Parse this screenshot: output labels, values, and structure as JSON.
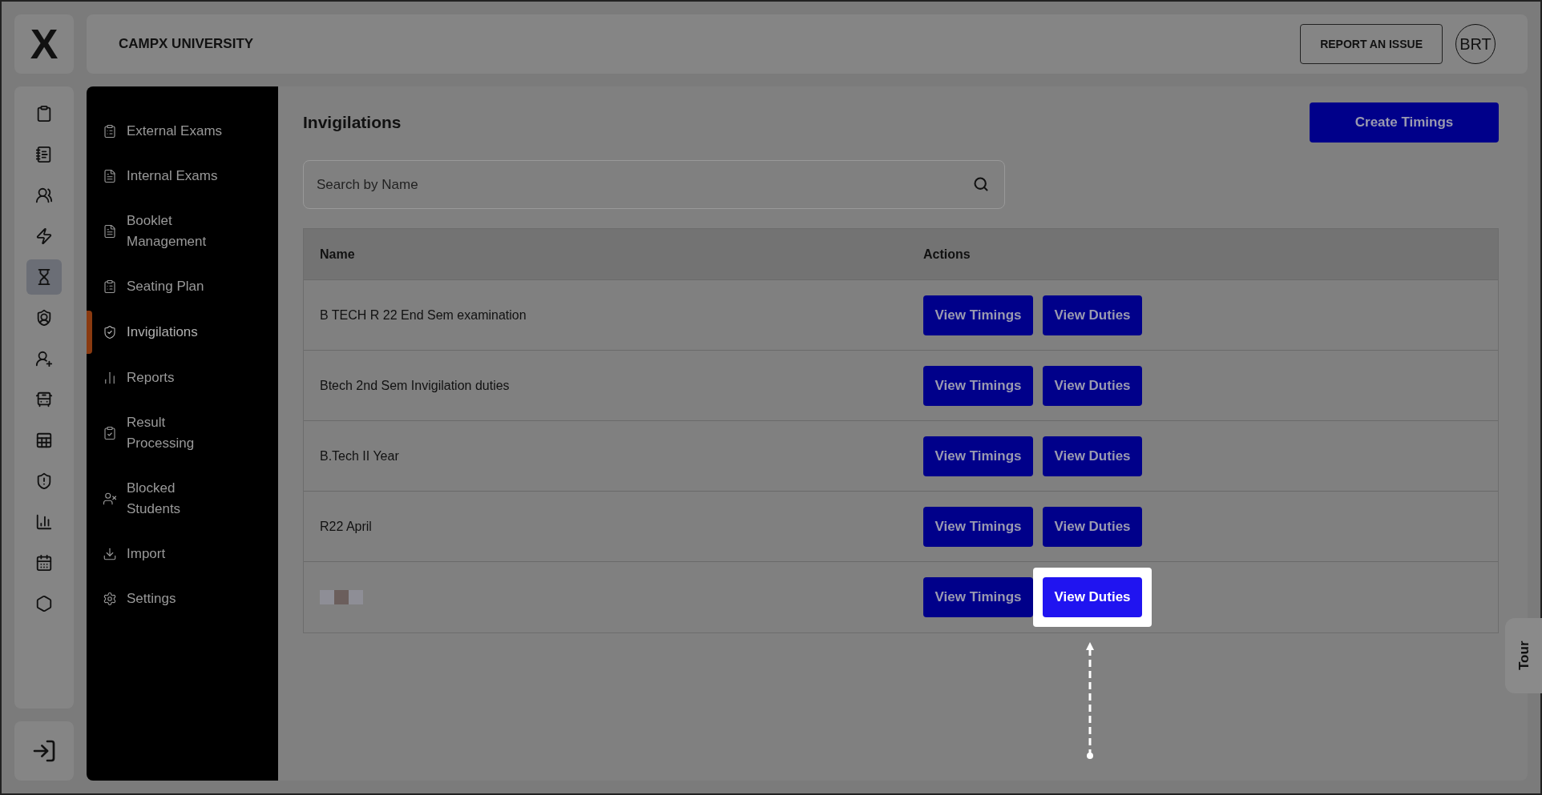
{
  "logo": "X",
  "header": {
    "title": "CAMPX UNIVERSITY",
    "report_button": "REPORT AN ISSUE",
    "avatar": "BRT"
  },
  "rail": [
    {
      "selected": false
    },
    {
      "selected": false
    },
    {
      "selected": false
    },
    {
      "selected": false
    },
    {
      "selected": true
    },
    {
      "selected": false
    },
    {
      "selected": false
    },
    {
      "selected": false
    },
    {
      "selected": false
    },
    {
      "selected": false
    },
    {
      "selected": false
    },
    {
      "selected": false
    },
    {
      "selected": false
    }
  ],
  "sidebar": {
    "items": [
      {
        "label": "External Exams",
        "selected": false
      },
      {
        "label": "Internal Exams",
        "selected": false
      },
      {
        "label": "Booklet Management",
        "selected": false
      },
      {
        "label": "Seating Plan",
        "selected": false
      },
      {
        "label": "Invigilations",
        "selected": true
      },
      {
        "label": "Reports",
        "selected": false
      },
      {
        "label": "Result Processing",
        "selected": false
      },
      {
        "label": "Blocked Students",
        "selected": false
      },
      {
        "label": "Import",
        "selected": false
      },
      {
        "label": "Settings",
        "selected": false
      }
    ]
  },
  "page": {
    "title": "Invigilations",
    "create_button": "Create Timings",
    "search": {
      "placeholder": "Search by Name"
    }
  },
  "table": {
    "columns": [
      "Name",
      "Actions"
    ],
    "rows": [
      {
        "name": "B TECH R 22 End Sem examination",
        "name_blurred": false,
        "timings_button": "View Timings",
        "duties_button": "View Duties",
        "duties_highlighted": false
      },
      {
        "name": "Btech 2nd Sem Invigilation duties",
        "name_blurred": false,
        "timings_button": "View Timings",
        "duties_button": "View Duties",
        "duties_highlighted": false
      },
      {
        "name": "B.Tech II Year",
        "name_blurred": false,
        "timings_button": "View Timings",
        "duties_button": "View Duties",
        "duties_highlighted": false
      },
      {
        "name": "R22 April",
        "name_blurred": false,
        "timings_button": "View Timings",
        "duties_button": "View Duties",
        "duties_highlighted": false
      },
      {
        "name_blurred": true,
        "timings_button": "View Timings",
        "duties_button": "View Duties",
        "duties_highlighted": true
      }
    ]
  },
  "tour_tab": "Tour"
}
